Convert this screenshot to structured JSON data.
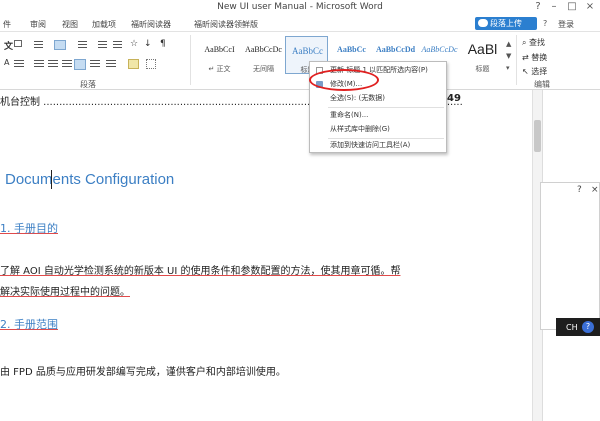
{
  "window": {
    "title": "New UI user Manual - Microsoft Word",
    "controls": [
      "?",
      "–",
      "□",
      "×"
    ]
  },
  "menubar": {
    "tabs": [
      "件",
      "审阅",
      "视图",
      "加载项",
      "福昕阅读器",
      "福昕阅读器领鲜版"
    ],
    "upload_label": "段落上传",
    "login_label": "登录",
    "help_label": "?"
  },
  "ribbon": {
    "paragraph_group_label": "段落",
    "styles": [
      {
        "sample": "AaBbCcI",
        "caption": "↵ 正文"
      },
      {
        "sample": "AaBbCcDc",
        "caption": "无间隔"
      },
      {
        "sample": "AaBbCc",
        "caption": "标题"
      },
      {
        "sample": "AaBbCc",
        "caption": ""
      },
      {
        "sample": "AaBbCcDd",
        "caption": ""
      },
      {
        "sample": "AaBbCcDc",
        "caption": ""
      },
      {
        "sample": "AaBl",
        "caption": "标题"
      }
    ],
    "editing": {
      "find": "查找",
      "replace": "替换",
      "select": "选择",
      "edit_group_label": "编辑"
    }
  },
  "context_menu": {
    "items": [
      "更新 标题 1 以匹配所选内容(P)",
      "修改(M)...",
      "全选(S): (无数据)",
      "重命名(N)...",
      "从样式库中删除(G)",
      "添加到快速访问工具栏(A)"
    ]
  },
  "document": {
    "toc_text": "机台控制",
    "toc_page": "49",
    "heading": "Documents Configuration",
    "section1_title": "1. 手册目的",
    "section1_para_line1": "了解 AOI 自动光学检测系统的新版本 UI 的使用条件和参数配置的方法，使其用章可循。帮",
    "section1_para_line2": "解决实际使用过程中的问题。",
    "section2_title": "2. 手册范围",
    "section2_para": "由 FPD 品质与应用研发部编写完成，谨供客户和内部培训使用。"
  },
  "language_bar": {
    "lang": "CH",
    "help": "?"
  },
  "dialog_controls": [
    "?",
    "×"
  ],
  "colors": {
    "accent_blue": "#3c7fc4",
    "upload_button": "#2b7fd0",
    "annotation_red": "#e02020"
  }
}
